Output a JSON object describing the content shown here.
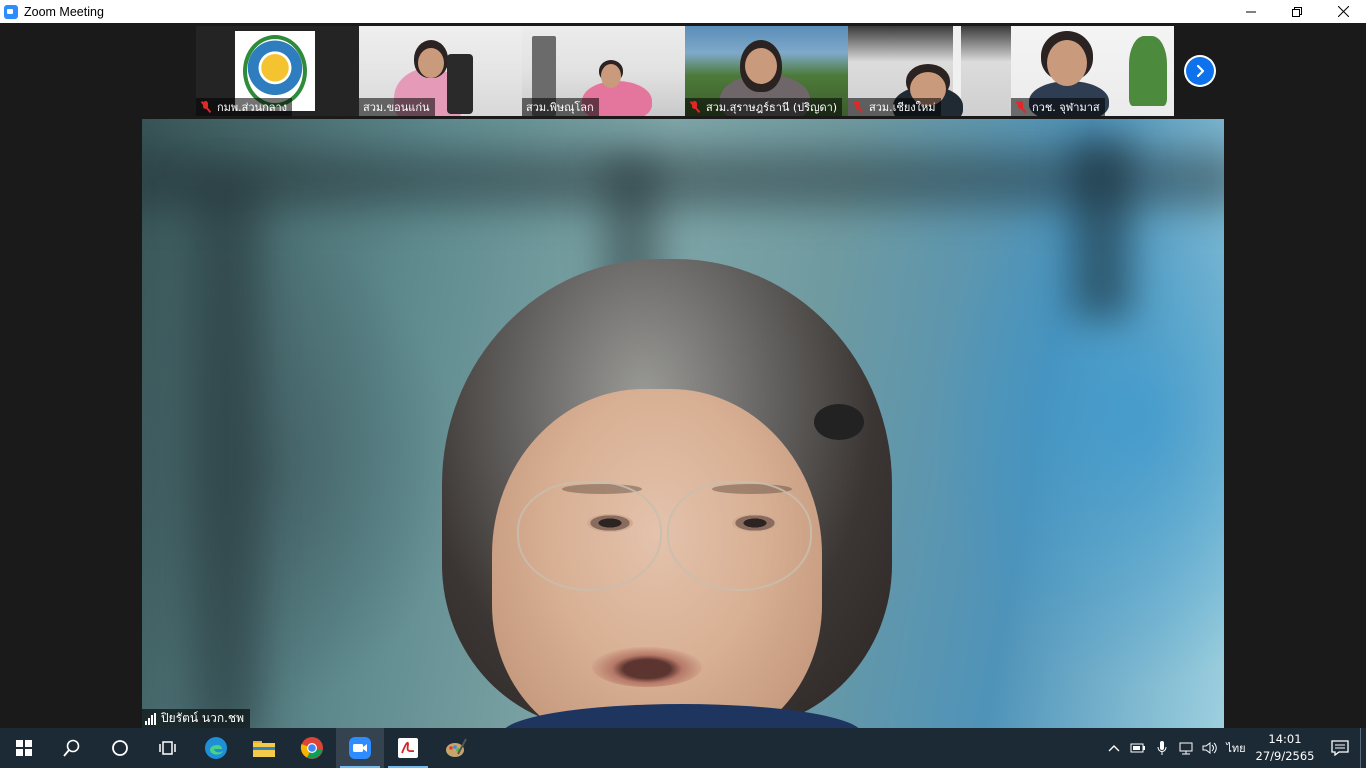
{
  "window": {
    "title": "Zoom Meeting",
    "controls": {
      "minimize": "—",
      "restore": "❐",
      "close": "✕"
    }
  },
  "gallery": {
    "tiles": [
      {
        "name": "กมพ.ส่วนกลาง",
        "muted": true
      },
      {
        "name": "สวม.ขอนแก่น",
        "muted": false
      },
      {
        "name": "สวม.พิษณุโลก",
        "muted": false
      },
      {
        "name": "สวม.สุราษฎร์ธานี (ปริญดา)",
        "muted": true
      },
      {
        "name": "สวม.เชียงใหม่",
        "muted": true
      },
      {
        "name": "กวช. จุฬามาส",
        "muted": true
      }
    ],
    "next_page_icon": "chevron-right-icon"
  },
  "active_speaker": {
    "name": "ปิยรัตน์ นวก.ชพ"
  },
  "taskbar": {
    "apps": [
      {
        "name": "start",
        "icon": "windows-icon"
      },
      {
        "name": "search",
        "icon": "search-icon"
      },
      {
        "name": "cortana",
        "icon": "circle-icon"
      },
      {
        "name": "task-view",
        "icon": "task-view-icon"
      },
      {
        "name": "edge",
        "icon": "edge-icon"
      },
      {
        "name": "file-explorer",
        "icon": "folder-icon"
      },
      {
        "name": "chrome",
        "icon": "chrome-icon"
      },
      {
        "name": "zoom",
        "icon": "zoom-icon"
      },
      {
        "name": "acrobat",
        "icon": "pdf-icon"
      },
      {
        "name": "paint",
        "icon": "paint-icon"
      }
    ],
    "tray": {
      "language": "ไทย",
      "time": "14:01",
      "date": "27/9/2565"
    }
  },
  "colors": {
    "zoom_blue": "#0e72ed",
    "muted_red": "#e02828",
    "taskbar_bg": "#1c2a35",
    "meeting_bg": "#1a1a1a"
  }
}
